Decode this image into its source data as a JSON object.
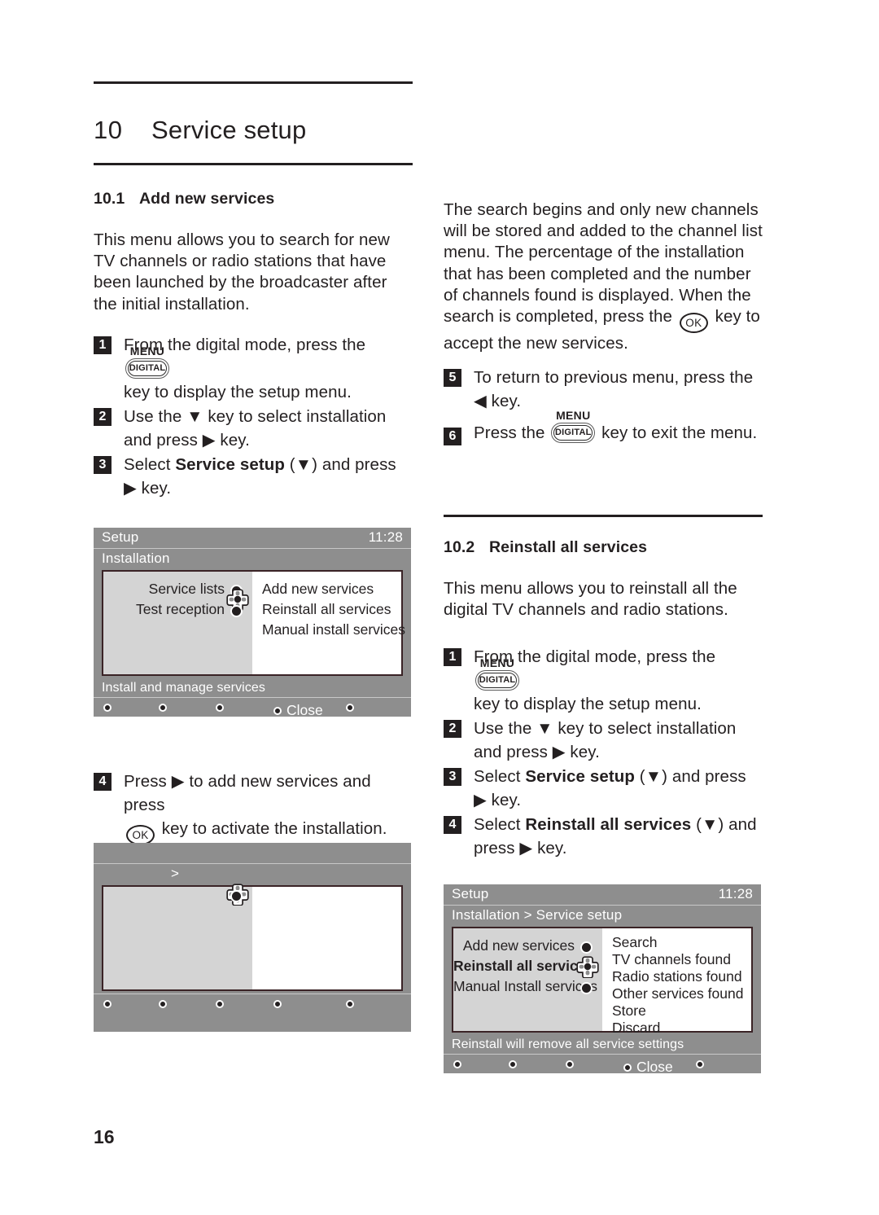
{
  "page": {
    "number": "16"
  },
  "chapter": {
    "number": "10",
    "title": "Service setup"
  },
  "sections": {
    "add_new_services": {
      "number": "10.1",
      "title": "Add new services",
      "intro": "This menu allows you to search for new TV channels or radio stations that have been launched by the broadcaster after the initial installation.",
      "steps": {
        "s1_a": "From the digital mode, press the",
        "s1_b": "key to display the setup menu.",
        "s2": "Use the ▼ key to select installation and press ▶ key.",
        "s3_a": "Select",
        "s3_bold": "Service setup",
        "s3_b": "(▼) and press ▶ key.",
        "s4_a": "Press ▶ to add new services and press",
        "s4_b": "key to activate the installation.",
        "s5_a": "To return to previous menu, press the ◀ key.",
        "s6_a": "Press the",
        "s6_b": "key to exit the menu."
      },
      "continuation": "The search begins and only new channels will be stored and added to the channel list menu. The percentage of the installation that has been completed and the number of channels found is displayed. When the search is completed, press the",
      "continuation_tail": "key to accept the new services."
    },
    "reinstall_all_services": {
      "number": "10.2",
      "title": "Reinstall all services",
      "intro": "This menu allows you to reinstall all the digital TV channels and radio stations.",
      "steps": {
        "s1_a": "From the digital mode, press the",
        "s1_b": "key to display the setup menu.",
        "s2": "Use the ▼ key to select installation and press ▶ key.",
        "s3_a": "Select",
        "s3_bold": "Service setup",
        "s3_b": "(▼) and press ▶ key.",
        "s4_a": "Select",
        "s4_bold": "Reinstall all services",
        "s4_b": "(▼) and press ▶ key."
      }
    }
  },
  "keys": {
    "menu_label": "MENU",
    "digital_label": "DIGITAL",
    "ok_label": "OK"
  },
  "tv_screen_1": {
    "title": "Setup",
    "clock": "11:28",
    "breadcrumb": "Installation",
    "left_menu": [
      {
        "label": "Service lists",
        "selected": false
      },
      {
        "label": "",
        "selected": true
      },
      {
        "label": "Test reception",
        "selected": false
      }
    ],
    "right_options": [
      "Add new services",
      "Reinstall all services",
      "Manual install services"
    ],
    "status": "Install and manage services",
    "buttons": [
      {
        "label": ""
      },
      {
        "label": ""
      },
      {
        "label": ""
      },
      {
        "label": "Close"
      },
      {
        "label": ""
      }
    ]
  },
  "tv_screen_2": {
    "title": "",
    "clock": "",
    "breadcrumb": ">",
    "left_menu": [
      {
        "label": "",
        "selected": true
      },
      {
        "label": "",
        "selected": false
      },
      {
        "label": "",
        "selected": false
      }
    ],
    "right_options": [
      "",
      "",
      ""
    ],
    "status": "",
    "buttons": [
      {
        "label": ""
      },
      {
        "label": ""
      },
      {
        "label": ""
      },
      {
        "label": ""
      },
      {
        "label": ""
      }
    ]
  },
  "tv_screen_3": {
    "title": "Setup",
    "clock": "11:28",
    "breadcrumb": "Installation > Service setup",
    "left_menu": [
      {
        "label": "Add new services",
        "selected": false
      },
      {
        "label": "Reinstall all services",
        "selected": true
      },
      {
        "label": "Manual Install services",
        "selected": false
      }
    ],
    "right_options": [
      "Search",
      "TV channels found",
      "Radio stations found",
      "Other services found",
      "Store",
      "Discard"
    ],
    "status": "Reinstall will remove all service settings",
    "buttons": [
      {
        "label": ""
      },
      {
        "label": ""
      },
      {
        "label": ""
      },
      {
        "label": "Close"
      },
      {
        "label": ""
      }
    ]
  },
  "colors": {
    "ink": "#231f20",
    "tv_chrome": "#8e8e8e",
    "tv_pane_left": "#d4d4d4",
    "tv_pane_right": "#ffffff",
    "tv_border": "#3a2326"
  }
}
